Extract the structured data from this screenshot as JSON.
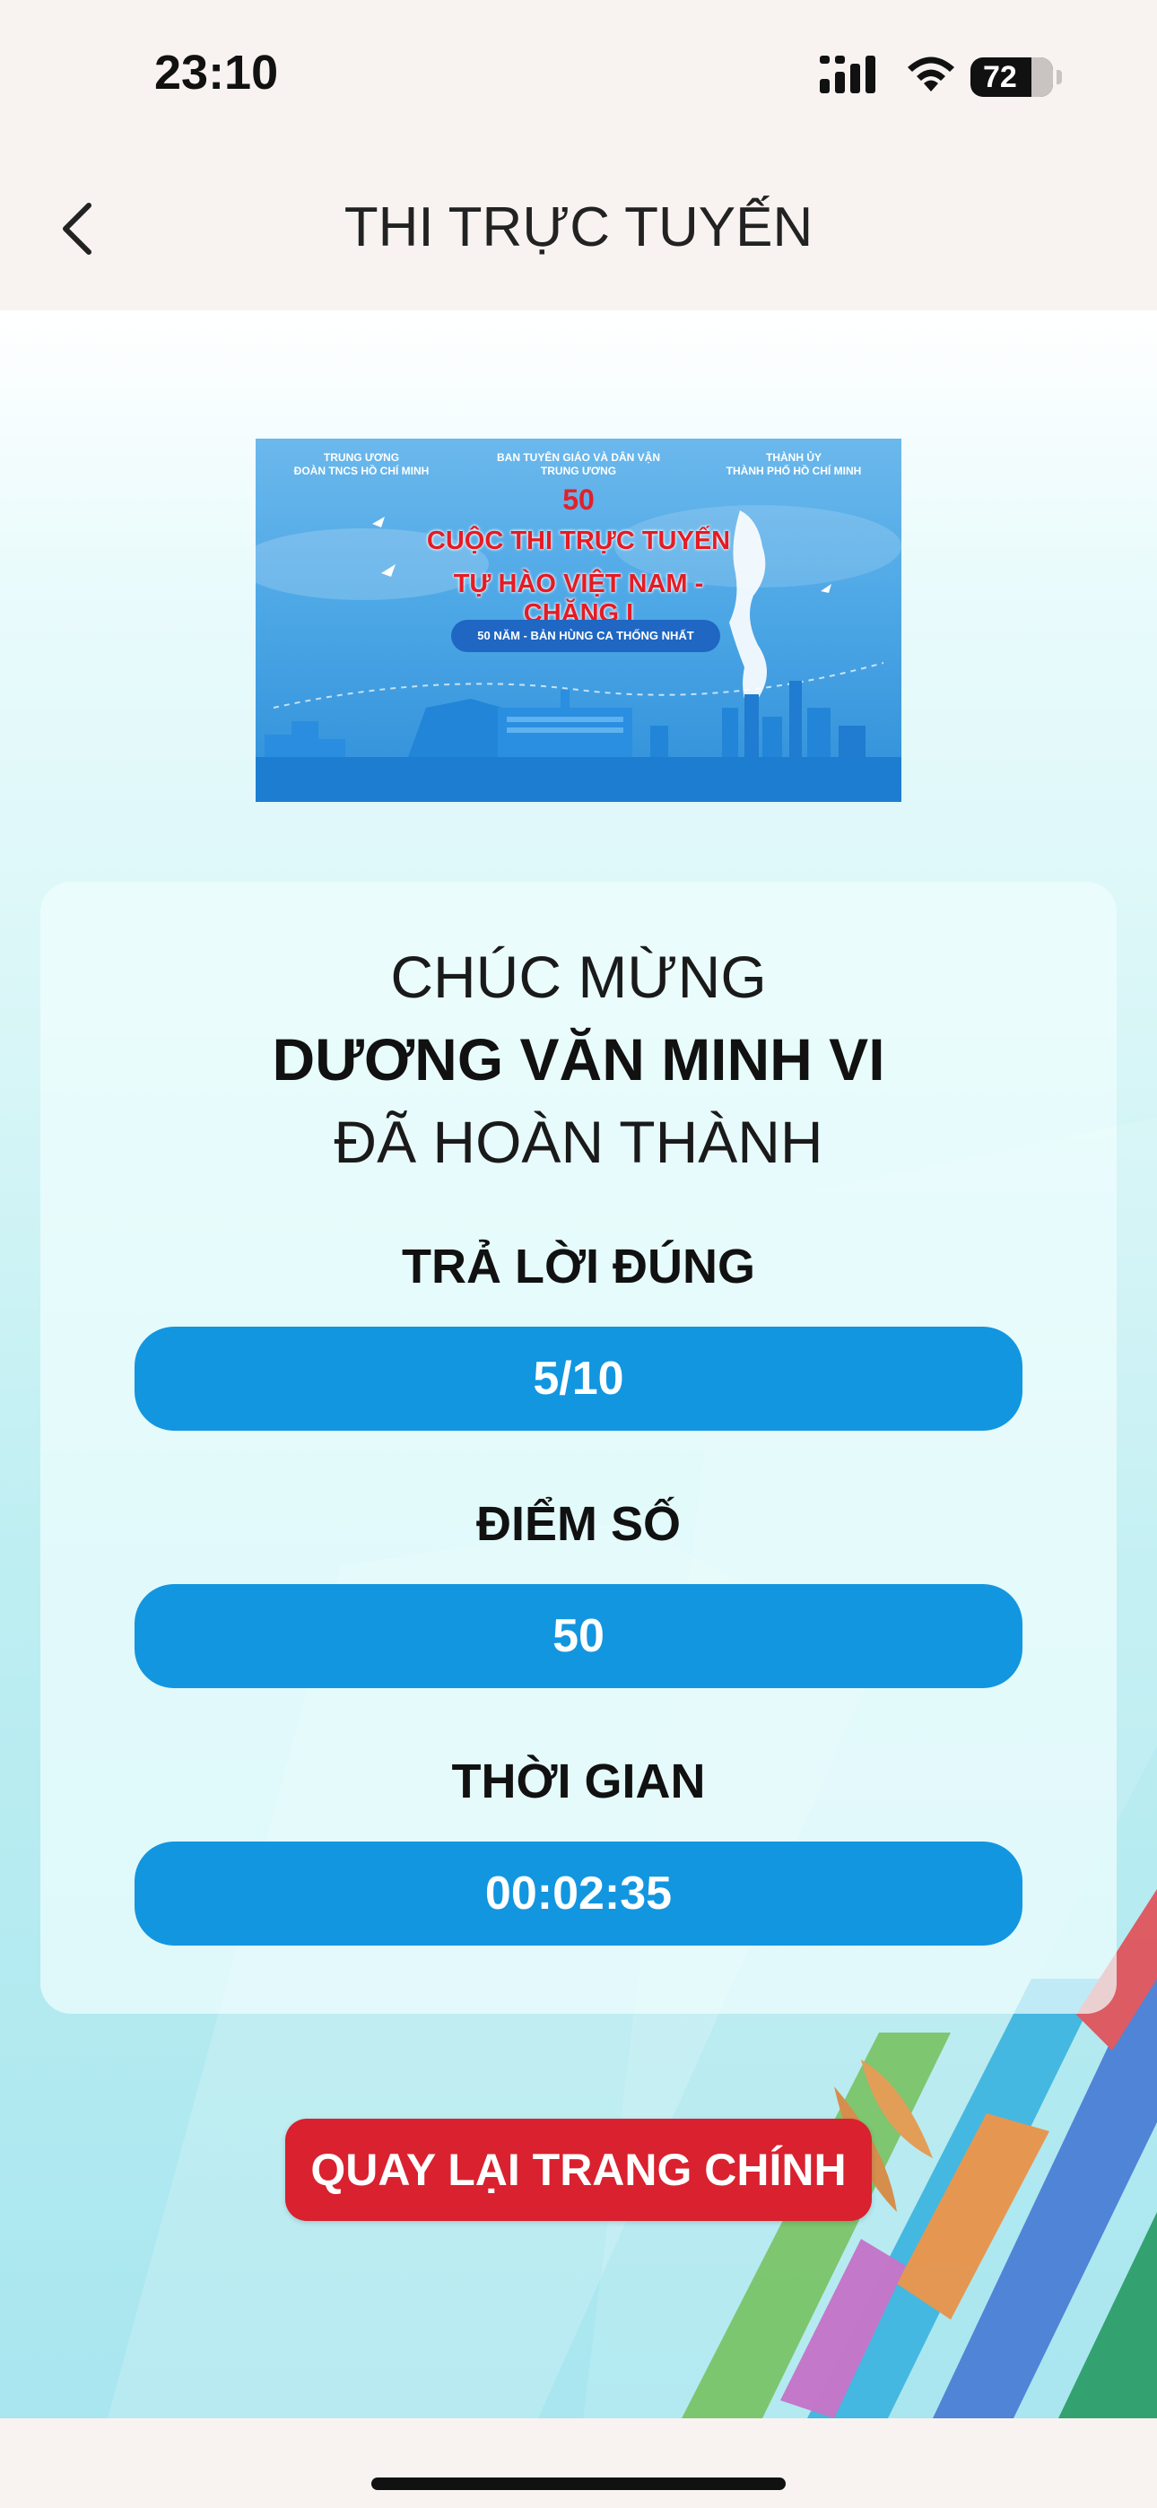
{
  "status_bar": {
    "time": "23:10",
    "battery": "72",
    "icons": [
      "cellular-signal-icon",
      "wifi-icon",
      "battery-icon"
    ]
  },
  "nav": {
    "title": "THI TRỰC TUYẾN",
    "back_icon": "chevron-left-icon"
  },
  "banner": {
    "org_left_line1": "TRUNG ƯƠNG",
    "org_left_line2": "ĐOÀN TNCS HỒ CHÍ MINH",
    "org_center_line1": "BAN TUYÊN GIÁO VÀ DÂN VẬN",
    "org_center_line2": "TRUNG ƯƠNG",
    "org_right_line1": "THÀNH ỦY",
    "org_right_line2": "THÀNH PHỐ HỒ CHÍ MINH",
    "logo": "50",
    "title_line1": "CUỘC THI TRỰC TUYẾN",
    "title_line2": "TỰ HÀO VIỆT NAM - CHẶNG I",
    "tagline": "50 NĂM - BẢN HÙNG CA THỐNG NHẤT"
  },
  "result": {
    "congrats": "CHÚC MỪNG",
    "name": "DƯƠNG VĂN MINH VI",
    "completed": "ĐÃ HOÀN THÀNH",
    "correct_label": "TRẢ LỜI ĐÚNG",
    "correct_value": "5/10",
    "score_label": "ĐIỂM SỐ",
    "score_value": "50",
    "time_label": "THỜI GIAN",
    "time_value": "00:02:35"
  },
  "actions": {
    "home_button": "QUAY LẠI TRANG CHÍNH"
  },
  "colors": {
    "accent_blue": "#1296e0",
    "button_red": "#d9212f",
    "header_bg": "#f8f3f1"
  }
}
